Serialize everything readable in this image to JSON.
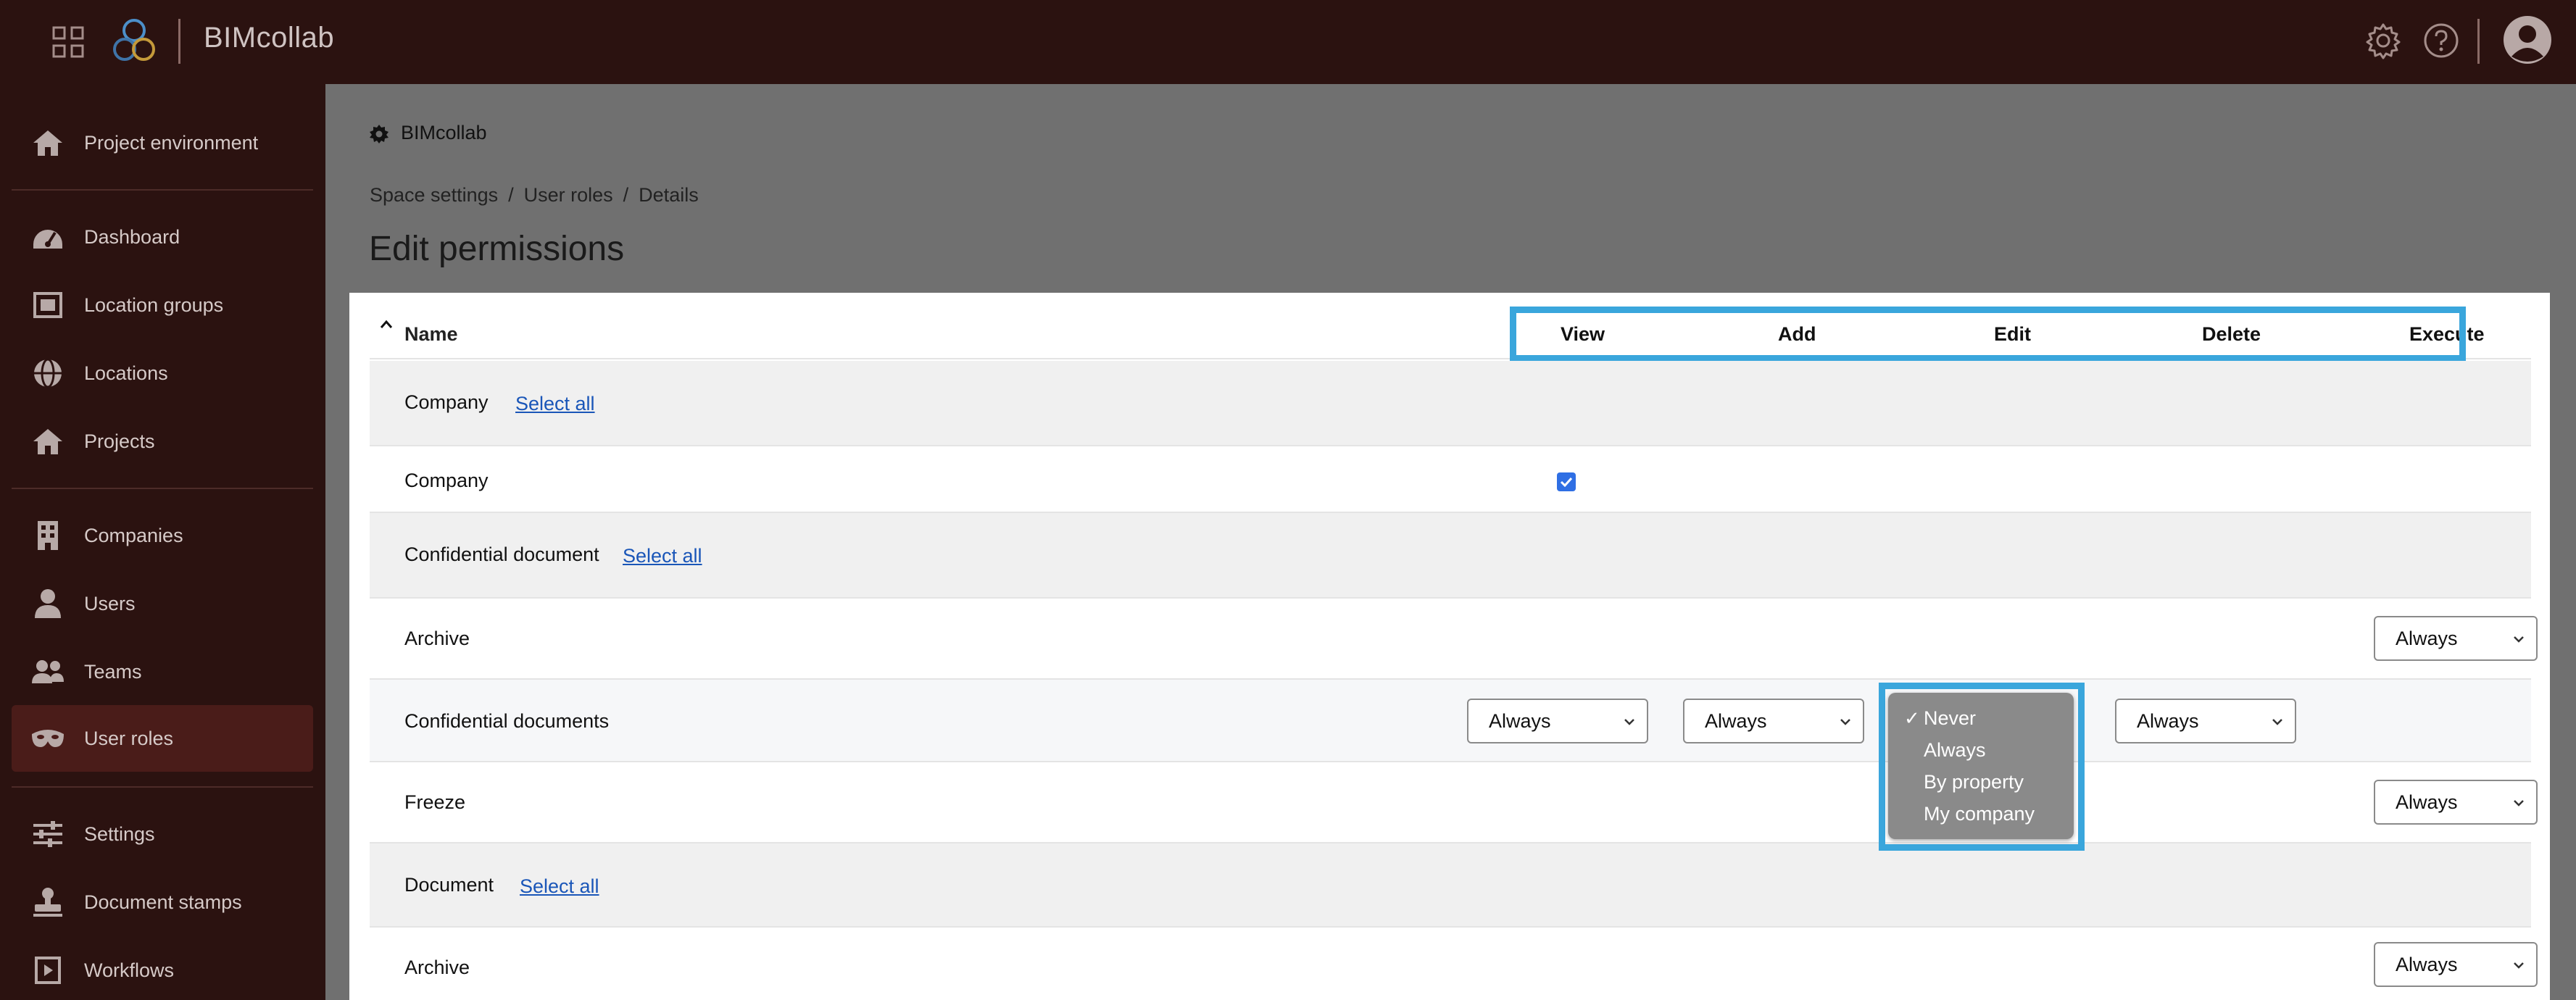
{
  "app": {
    "brand": "BIMcollab"
  },
  "sidebar": {
    "items": [
      {
        "label": "Project environment",
        "icon": "home-icon"
      },
      {
        "label": "Dashboard",
        "icon": "gauge-icon"
      },
      {
        "label": "Location groups",
        "icon": "location-groups-icon"
      },
      {
        "label": "Locations",
        "icon": "globe-icon"
      },
      {
        "label": "Projects",
        "icon": "home-icon"
      },
      {
        "label": "Companies",
        "icon": "building-icon"
      },
      {
        "label": "Users",
        "icon": "user-icon"
      },
      {
        "label": "Teams",
        "icon": "team-icon"
      },
      {
        "label": "User roles",
        "icon": "mask-icon"
      },
      {
        "label": "Settings",
        "icon": "sliders-icon"
      },
      {
        "label": "Document stamps",
        "icon": "stamp-icon"
      },
      {
        "label": "Workflows",
        "icon": "workflow-icon"
      }
    ],
    "active": "User roles"
  },
  "space": {
    "name": "BIMcollab"
  },
  "breadcrumb": {
    "items": [
      "Space settings",
      "User roles",
      "Details"
    ],
    "separator": "/"
  },
  "page": {
    "title": "Edit permissions"
  },
  "table": {
    "name_header": "Name",
    "columns": [
      "View",
      "Add",
      "Edit",
      "Delete",
      "Execute"
    ],
    "select_all_label": "Select all",
    "rows": [
      {
        "name": "Company",
        "type": "group"
      },
      {
        "name": "Company",
        "type": "item"
      },
      {
        "name": "Confidential document",
        "type": "group"
      },
      {
        "name": "Archive",
        "type": "item",
        "execute": "Always"
      },
      {
        "name": "Confidential documents",
        "type": "item",
        "view": "Always",
        "add": "Always",
        "delete": "Always"
      },
      {
        "name": "Freeze",
        "type": "item",
        "execute": "Always"
      },
      {
        "name": "Document",
        "type": "group"
      },
      {
        "name": "Archive",
        "type": "item",
        "execute": "Always"
      }
    ]
  },
  "dropdown": {
    "options": [
      "Never",
      "Always",
      "By property",
      "My company"
    ],
    "selected": "Never",
    "check_glyph": "✓"
  },
  "colors": {
    "topbar": "#2b1210",
    "sidebar_active": "#4a1c19",
    "highlight": "#3aa6dc",
    "link": "#1a56b8",
    "checkbox": "#2f6fe4"
  }
}
